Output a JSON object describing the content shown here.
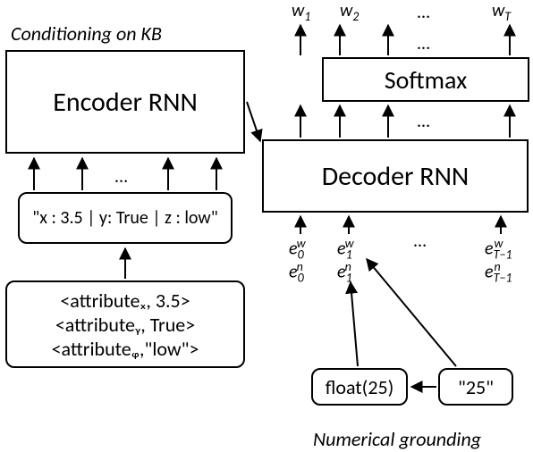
{
  "labels": {
    "conditioning": "Conditioning on KB",
    "grounding": "Numerical grounding"
  },
  "boxes": {
    "encoder": "Encoder RNN",
    "decoder": "Decoder RNN",
    "softmax": "Softmax",
    "kb_serial": "\"x : 3.5 | y: True | z : low\"",
    "kb_tuples_line1": "<attributeₓ,   3.5>",
    "kb_tuples_line2": "<attributeᵧ,  True>",
    "kb_tuples_line3": "<attributeᵩ,\"low\">",
    "float25": "float(25)",
    "str25": "\"25\""
  },
  "outputs": {
    "w1": "w₁",
    "w2": "w₂",
    "wT": "w_T"
  },
  "embeds": {
    "e0w": "e₀ʷ",
    "e1w": "e₁ʷ",
    "eTw": "e_{T-1}^w",
    "e0n": "e₀ⁿ",
    "e1n": "e₁ⁿ",
    "eTn": "e_{T-1}^n"
  },
  "misc": {
    "ellipsis": "..."
  },
  "chart_data": {
    "type": "diagram",
    "nodes": [
      {
        "id": "kb_tuples",
        "text": "<attribute_x, 3.5>; <attribute_y, True>; <attribute_z, \"low\">"
      },
      {
        "id": "kb_serial",
        "text": "\"x : 3.5 | y: True | z : low\""
      },
      {
        "id": "encoder",
        "text": "Encoder RNN"
      },
      {
        "id": "decoder",
        "text": "Decoder RNN"
      },
      {
        "id": "softmax",
        "text": "Softmax"
      },
      {
        "id": "str25",
        "text": "\"25\""
      },
      {
        "id": "float25",
        "text": "float(25)"
      },
      {
        "id": "outputs",
        "text": "w_1, w_2, ..., w_T"
      }
    ],
    "edges": [
      {
        "from": "kb_tuples",
        "to": "kb_serial"
      },
      {
        "from": "kb_serial",
        "to": "encoder",
        "multiplicity": "many"
      },
      {
        "from": "encoder",
        "to": "decoder"
      },
      {
        "from": "str25",
        "to": "float25"
      },
      {
        "from": "float25",
        "to": "decoder",
        "label": "e_t^n"
      },
      {
        "from": "str25",
        "to": "decoder",
        "label": "e_t^w"
      },
      {
        "from": "decoder",
        "to": "softmax",
        "multiplicity": "many"
      },
      {
        "from": "softmax",
        "to": "outputs",
        "multiplicity": "many"
      }
    ],
    "annotations": [
      {
        "text": "Conditioning on KB",
        "target": "encoder"
      },
      {
        "text": "Numerical grounding",
        "target": "decoder inputs"
      }
    ]
  }
}
